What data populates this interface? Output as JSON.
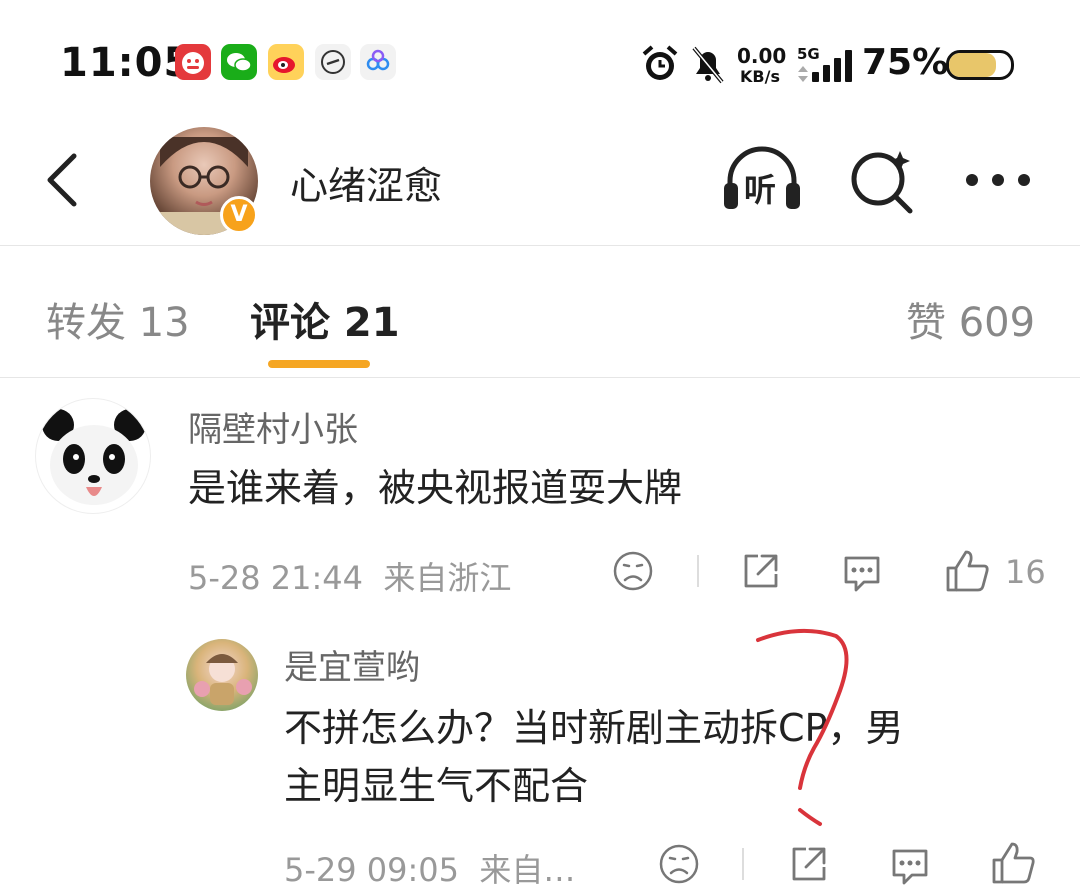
{
  "status_bar": {
    "time": "11:05",
    "net_speed_value": "0.00",
    "net_speed_unit": "KB/s",
    "network": "5G",
    "battery_percent": "75%",
    "battery_level": 0.75,
    "app_icons": [
      "jd-icon",
      "wechat-icon",
      "weibo-icon",
      "clock-app-icon",
      "cloud-app-icon"
    ]
  },
  "header": {
    "username": "心绪涩愈",
    "listen_label": "听",
    "verified_badge": "V"
  },
  "tabs": [
    {
      "label": "转发 13",
      "active": false
    },
    {
      "label": "评论 21",
      "active": true
    },
    {
      "label": "赞 609",
      "active": false
    }
  ],
  "comments": [
    {
      "name": "隔壁村小张",
      "text": "是谁来着，被央视报道耍大牌",
      "meta": "5-28 21:44  来自浙江",
      "like_count": "16"
    },
    {
      "name": "是宜萱哟",
      "text_line1": "不拼怎么办？当时新剧主动拆CP，男",
      "text_line2": "主明显生气不配合",
      "meta": "5-29 09:05  来自…",
      "like_count": ""
    }
  ],
  "colors": {
    "accent": "#f5a623",
    "muted": "#999999",
    "annotation": "#d9343b"
  }
}
